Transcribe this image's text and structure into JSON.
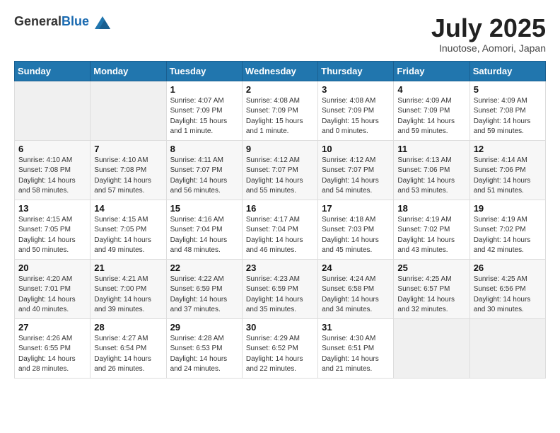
{
  "header": {
    "logo_general": "General",
    "logo_blue": "Blue",
    "title": "July 2025",
    "location": "Inuotose, Aomori, Japan"
  },
  "weekdays": [
    "Sunday",
    "Monday",
    "Tuesday",
    "Wednesday",
    "Thursday",
    "Friday",
    "Saturday"
  ],
  "weeks": [
    [
      {
        "day": "",
        "sunrise": "",
        "sunset": "",
        "daylight": ""
      },
      {
        "day": "",
        "sunrise": "",
        "sunset": "",
        "daylight": ""
      },
      {
        "day": "1",
        "sunrise": "Sunrise: 4:07 AM",
        "sunset": "Sunset: 7:09 PM",
        "daylight": "Daylight: 15 hours and 1 minute."
      },
      {
        "day": "2",
        "sunrise": "Sunrise: 4:08 AM",
        "sunset": "Sunset: 7:09 PM",
        "daylight": "Daylight: 15 hours and 1 minute."
      },
      {
        "day": "3",
        "sunrise": "Sunrise: 4:08 AM",
        "sunset": "Sunset: 7:09 PM",
        "daylight": "Daylight: 15 hours and 0 minutes."
      },
      {
        "day": "4",
        "sunrise": "Sunrise: 4:09 AM",
        "sunset": "Sunset: 7:09 PM",
        "daylight": "Daylight: 14 hours and 59 minutes."
      },
      {
        "day": "5",
        "sunrise": "Sunrise: 4:09 AM",
        "sunset": "Sunset: 7:08 PM",
        "daylight": "Daylight: 14 hours and 59 minutes."
      }
    ],
    [
      {
        "day": "6",
        "sunrise": "Sunrise: 4:10 AM",
        "sunset": "Sunset: 7:08 PM",
        "daylight": "Daylight: 14 hours and 58 minutes."
      },
      {
        "day": "7",
        "sunrise": "Sunrise: 4:10 AM",
        "sunset": "Sunset: 7:08 PM",
        "daylight": "Daylight: 14 hours and 57 minutes."
      },
      {
        "day": "8",
        "sunrise": "Sunrise: 4:11 AM",
        "sunset": "Sunset: 7:07 PM",
        "daylight": "Daylight: 14 hours and 56 minutes."
      },
      {
        "day": "9",
        "sunrise": "Sunrise: 4:12 AM",
        "sunset": "Sunset: 7:07 PM",
        "daylight": "Daylight: 14 hours and 55 minutes."
      },
      {
        "day": "10",
        "sunrise": "Sunrise: 4:12 AM",
        "sunset": "Sunset: 7:07 PM",
        "daylight": "Daylight: 14 hours and 54 minutes."
      },
      {
        "day": "11",
        "sunrise": "Sunrise: 4:13 AM",
        "sunset": "Sunset: 7:06 PM",
        "daylight": "Daylight: 14 hours and 53 minutes."
      },
      {
        "day": "12",
        "sunrise": "Sunrise: 4:14 AM",
        "sunset": "Sunset: 7:06 PM",
        "daylight": "Daylight: 14 hours and 51 minutes."
      }
    ],
    [
      {
        "day": "13",
        "sunrise": "Sunrise: 4:15 AM",
        "sunset": "Sunset: 7:05 PM",
        "daylight": "Daylight: 14 hours and 50 minutes."
      },
      {
        "day": "14",
        "sunrise": "Sunrise: 4:15 AM",
        "sunset": "Sunset: 7:05 PM",
        "daylight": "Daylight: 14 hours and 49 minutes."
      },
      {
        "day": "15",
        "sunrise": "Sunrise: 4:16 AM",
        "sunset": "Sunset: 7:04 PM",
        "daylight": "Daylight: 14 hours and 48 minutes."
      },
      {
        "day": "16",
        "sunrise": "Sunrise: 4:17 AM",
        "sunset": "Sunset: 7:04 PM",
        "daylight": "Daylight: 14 hours and 46 minutes."
      },
      {
        "day": "17",
        "sunrise": "Sunrise: 4:18 AM",
        "sunset": "Sunset: 7:03 PM",
        "daylight": "Daylight: 14 hours and 45 minutes."
      },
      {
        "day": "18",
        "sunrise": "Sunrise: 4:19 AM",
        "sunset": "Sunset: 7:02 PM",
        "daylight": "Daylight: 14 hours and 43 minutes."
      },
      {
        "day": "19",
        "sunrise": "Sunrise: 4:19 AM",
        "sunset": "Sunset: 7:02 PM",
        "daylight": "Daylight: 14 hours and 42 minutes."
      }
    ],
    [
      {
        "day": "20",
        "sunrise": "Sunrise: 4:20 AM",
        "sunset": "Sunset: 7:01 PM",
        "daylight": "Daylight: 14 hours and 40 minutes."
      },
      {
        "day": "21",
        "sunrise": "Sunrise: 4:21 AM",
        "sunset": "Sunset: 7:00 PM",
        "daylight": "Daylight: 14 hours and 39 minutes."
      },
      {
        "day": "22",
        "sunrise": "Sunrise: 4:22 AM",
        "sunset": "Sunset: 6:59 PM",
        "daylight": "Daylight: 14 hours and 37 minutes."
      },
      {
        "day": "23",
        "sunrise": "Sunrise: 4:23 AM",
        "sunset": "Sunset: 6:59 PM",
        "daylight": "Daylight: 14 hours and 35 minutes."
      },
      {
        "day": "24",
        "sunrise": "Sunrise: 4:24 AM",
        "sunset": "Sunset: 6:58 PM",
        "daylight": "Daylight: 14 hours and 34 minutes."
      },
      {
        "day": "25",
        "sunrise": "Sunrise: 4:25 AM",
        "sunset": "Sunset: 6:57 PM",
        "daylight": "Daylight: 14 hours and 32 minutes."
      },
      {
        "day": "26",
        "sunrise": "Sunrise: 4:25 AM",
        "sunset": "Sunset: 6:56 PM",
        "daylight": "Daylight: 14 hours and 30 minutes."
      }
    ],
    [
      {
        "day": "27",
        "sunrise": "Sunrise: 4:26 AM",
        "sunset": "Sunset: 6:55 PM",
        "daylight": "Daylight: 14 hours and 28 minutes."
      },
      {
        "day": "28",
        "sunrise": "Sunrise: 4:27 AM",
        "sunset": "Sunset: 6:54 PM",
        "daylight": "Daylight: 14 hours and 26 minutes."
      },
      {
        "day": "29",
        "sunrise": "Sunrise: 4:28 AM",
        "sunset": "Sunset: 6:53 PM",
        "daylight": "Daylight: 14 hours and 24 minutes."
      },
      {
        "day": "30",
        "sunrise": "Sunrise: 4:29 AM",
        "sunset": "Sunset: 6:52 PM",
        "daylight": "Daylight: 14 hours and 22 minutes."
      },
      {
        "day": "31",
        "sunrise": "Sunrise: 4:30 AM",
        "sunset": "Sunset: 6:51 PM",
        "daylight": "Daylight: 14 hours and 21 minutes."
      },
      {
        "day": "",
        "sunrise": "",
        "sunset": "",
        "daylight": ""
      },
      {
        "day": "",
        "sunrise": "",
        "sunset": "",
        "daylight": ""
      }
    ]
  ]
}
